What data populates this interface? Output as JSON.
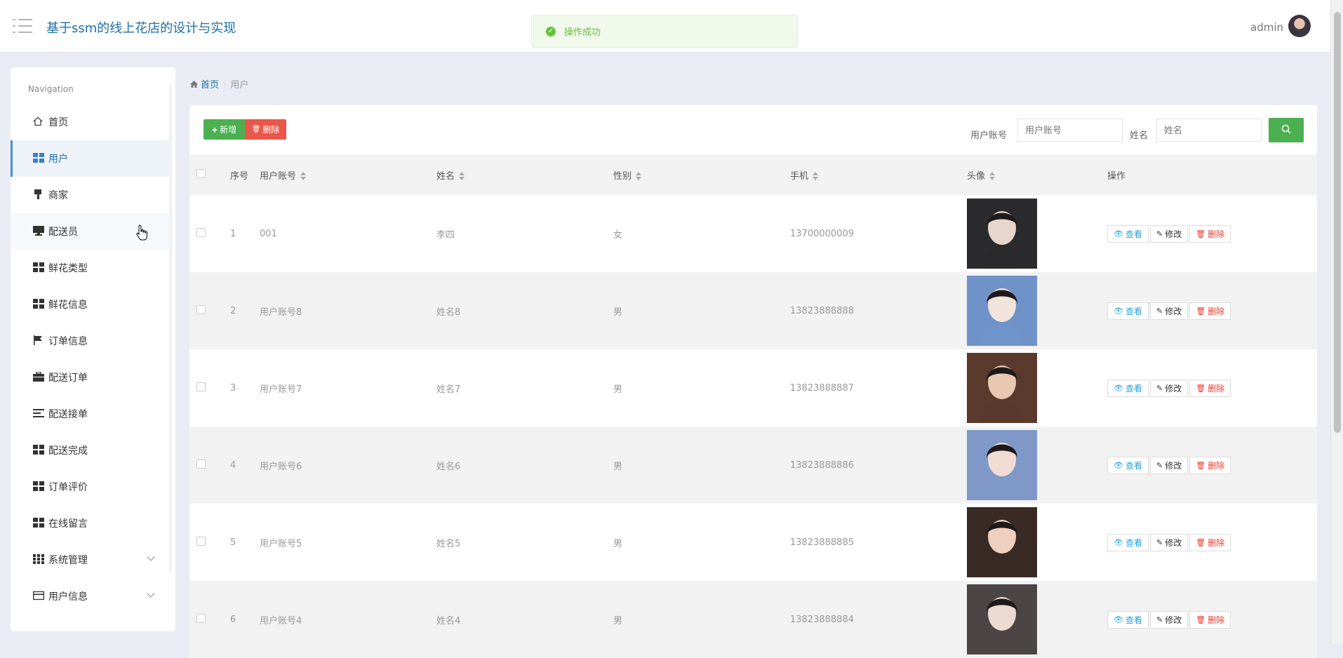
{
  "header": {
    "title": "基于ssm的线上花店的设计与实现",
    "toast": "操作成功",
    "username": "admin"
  },
  "sidebar": {
    "heading": "Navigation",
    "items": [
      {
        "label": "首页",
        "icon": "home-icon"
      },
      {
        "label": "用户",
        "icon": "grid-icon",
        "active": true
      },
      {
        "label": "商家",
        "icon": "brush-icon"
      },
      {
        "label": "配送员",
        "icon": "monitor-icon"
      },
      {
        "label": "鲜花类型",
        "icon": "grid-icon"
      },
      {
        "label": "鲜花信息",
        "icon": "grid-icon"
      },
      {
        "label": "订单信息",
        "icon": "flag-icon"
      },
      {
        "label": "配送订单",
        "icon": "briefcase-icon"
      },
      {
        "label": "配送接单",
        "icon": "list-icon"
      },
      {
        "label": "配送完成",
        "icon": "grid-icon"
      },
      {
        "label": "订单评价",
        "icon": "grid-icon"
      },
      {
        "label": "在线留言",
        "icon": "grid-icon"
      },
      {
        "label": "系统管理",
        "icon": "apps-icon",
        "expandable": true
      },
      {
        "label": "用户信息",
        "icon": "card-icon",
        "expandable": true
      }
    ]
  },
  "breadcrumb": {
    "home": "首页",
    "separator": "›",
    "current": "用户"
  },
  "toolbar": {
    "add_label": "新增",
    "delete_label": "删除",
    "account_label": "用户账号",
    "account_placeholder": "用户账号",
    "name_label": "姓名",
    "name_placeholder": "姓名"
  },
  "table": {
    "columns": [
      "序号",
      "用户账号",
      "姓名",
      "性别",
      "手机",
      "头像",
      "操作"
    ],
    "actions": {
      "view": "查看",
      "edit": "修改",
      "delete": "删除"
    },
    "rows": [
      {
        "index": "1",
        "account": "001",
        "name": "李四",
        "gender": "女",
        "phone": "13700000009",
        "avatar_colors": [
          "#2b2b2e",
          "#e8d6cc"
        ]
      },
      {
        "index": "2",
        "account": "用户账号8",
        "name": "姓名8",
        "gender": "男",
        "phone": "13823888888",
        "avatar_colors": [
          "#6f93c9",
          "#f1e4dc"
        ]
      },
      {
        "index": "3",
        "account": "用户账号7",
        "name": "姓名7",
        "gender": "男",
        "phone": "13823888887",
        "avatar_colors": [
          "#5a3a2c",
          "#e8c7b3"
        ]
      },
      {
        "index": "4",
        "account": "用户账号6",
        "name": "姓名6",
        "gender": "男",
        "phone": "13823888886",
        "avatar_colors": [
          "#7f98c8",
          "#f0dcd2"
        ]
      },
      {
        "index": "5",
        "account": "用户账号5",
        "name": "姓名5",
        "gender": "男",
        "phone": "13823888885",
        "avatar_colors": [
          "#3a2a25",
          "#efcfbd"
        ]
      },
      {
        "index": "6",
        "account": "用户账号4",
        "name": "姓名4",
        "gender": "男",
        "phone": "13823888884",
        "avatar_colors": [
          "#4b4545",
          "#eadad0"
        ]
      }
    ]
  }
}
